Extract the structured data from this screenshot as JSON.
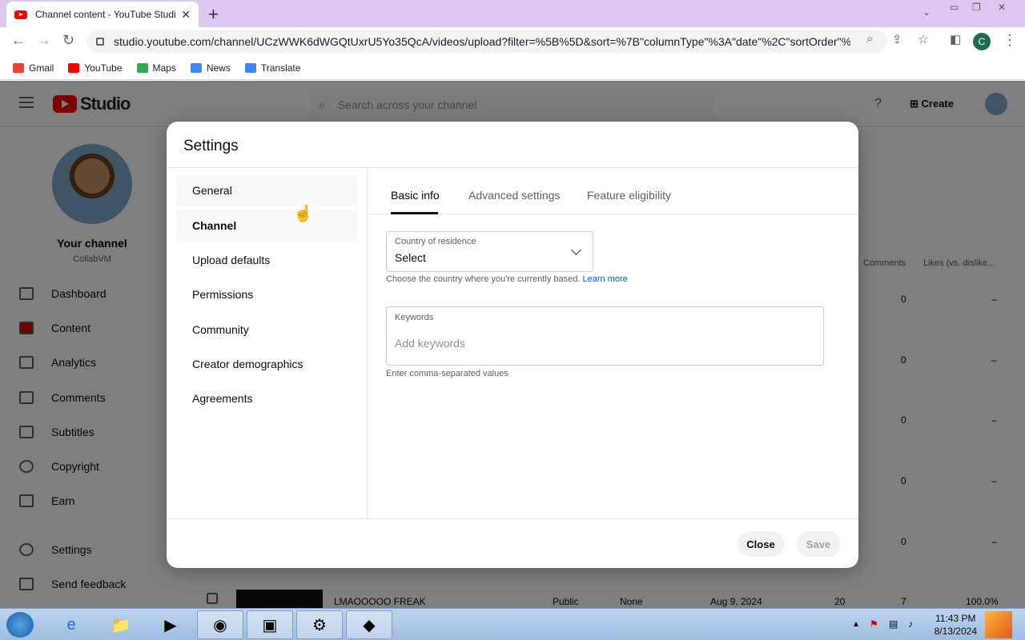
{
  "browser": {
    "tab_title": "Channel content - YouTube Studio",
    "url": "studio.youtube.com/channel/UCzWWK6dWGQtUxrU5Yo35QcA/videos/upload?filter=%5B%5D&sort=%7B\"columnType\"%3A\"date\"%2C\"sortOrder\"%...",
    "profile_initial": "C",
    "bookmarks": [
      {
        "label": "Gmail",
        "color": "#ea4335"
      },
      {
        "label": "YouTube",
        "color": "#ff0000"
      },
      {
        "label": "Maps",
        "color": "#34a853"
      },
      {
        "label": "News",
        "color": "#4285f4"
      },
      {
        "label": "Translate",
        "color": "#4285f4"
      }
    ]
  },
  "studio": {
    "logo_text": "Studio",
    "search_placeholder": "Search across your channel",
    "create_label": "Create",
    "channel_name": "Your channel",
    "channel_handle": "CollabVM",
    "sidebar": [
      {
        "label": "Dashboard"
      },
      {
        "label": "Content"
      },
      {
        "label": "Analytics"
      },
      {
        "label": "Comments"
      },
      {
        "label": "Subtitles"
      },
      {
        "label": "Copyright"
      },
      {
        "label": "Earn"
      },
      {
        "label": "Settings"
      },
      {
        "label": "Send feedback"
      }
    ],
    "table": {
      "col_comments": "Comments",
      "col_likes": "Likes (vs. dislike...",
      "row_visibility": "Public",
      "row_restrictions": "None",
      "row_title": "LMAOOOOO FREAK",
      "row_date": "Aug 9, 2024",
      "row_views": "20",
      "row_comments": "7",
      "row_likes": "100.0%",
      "zero": "0",
      "dash": "–"
    }
  },
  "modal": {
    "title": "Settings",
    "nav": [
      {
        "label": "General"
      },
      {
        "label": "Channel"
      },
      {
        "label": "Upload defaults"
      },
      {
        "label": "Permissions"
      },
      {
        "label": "Community"
      },
      {
        "label": "Creator demographics"
      },
      {
        "label": "Agreements"
      }
    ],
    "tabs": [
      {
        "label": "Basic info"
      },
      {
        "label": "Advanced settings"
      },
      {
        "label": "Feature eligibility"
      }
    ],
    "country": {
      "label": "Country of residence",
      "value": "Select",
      "help": "Choose the country where you're currently based.",
      "learn_more": "Learn more"
    },
    "keywords": {
      "label": "Keywords",
      "placeholder": "Add keywords",
      "help": "Enter comma-separated values"
    },
    "close_label": "Close",
    "save_label": "Save"
  },
  "taskbar": {
    "time": "11:43 PM",
    "date": "8/13/2024"
  }
}
